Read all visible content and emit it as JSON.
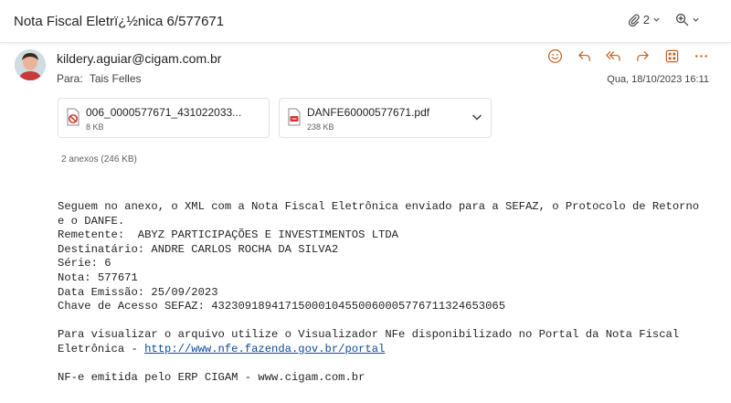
{
  "subject": "Nota Fiscal Eletrï¿½nica 6/577671",
  "toolbar": {
    "attach_count": "2",
    "zoom_icon": "zoom-icon",
    "paperclip_icon": "paperclip-icon"
  },
  "sender": {
    "email": "kildery.aguiar@cigam.com.br",
    "avatar": "avatar"
  },
  "recipients": {
    "label": "Para:",
    "to": "Tais Felles"
  },
  "date": "Qua, 18/10/2023 16:11",
  "actions": [
    "emoji-icon",
    "reply-icon",
    "reply-all-icon",
    "forward-icon",
    "apps-icon",
    "more-icon"
  ],
  "attachments": [
    {
      "name": "006_0000577671_431022033...",
      "size": "8 KB",
      "icon": "blocked-file-icon"
    },
    {
      "name": "DANFE60000577671.pdf",
      "size": "238 KB",
      "icon": "pdf-icon"
    }
  ],
  "attachments_summary": "2 anexos (246 KB)",
  "body": {
    "line1": "Seguem no anexo, o XML com a Nota Fiscal Eletrônica enviado para a SEFAZ, o Protocolo de Retorno",
    "line2": "e o DANFE.",
    "line3": "Remetente:  ABYZ PARTICIPAÇÕES E INVESTIMENTOS LTDA",
    "line4": "Destinatário: ANDRE CARLOS ROCHA DA SILVA2",
    "line5": "Série: 6",
    "line6": "Nota: 577671",
    "line7": "Data Emissão: 25/09/2023",
    "line8": "Chave de Acesso SEFAZ: 43230918941715000104550060005776711324653065",
    "line9": "Para visualizar o arquivo utilize o Visualizador NFe disponibilizado no Portal da Nota Fiscal",
    "line10_prefix": "Eletrônica - ",
    "link": "http://www.nfe.fazenda.gov.br/portal",
    "line11": "NF-e emitida pelo ERP CIGAM - www.cigam.com.br"
  }
}
